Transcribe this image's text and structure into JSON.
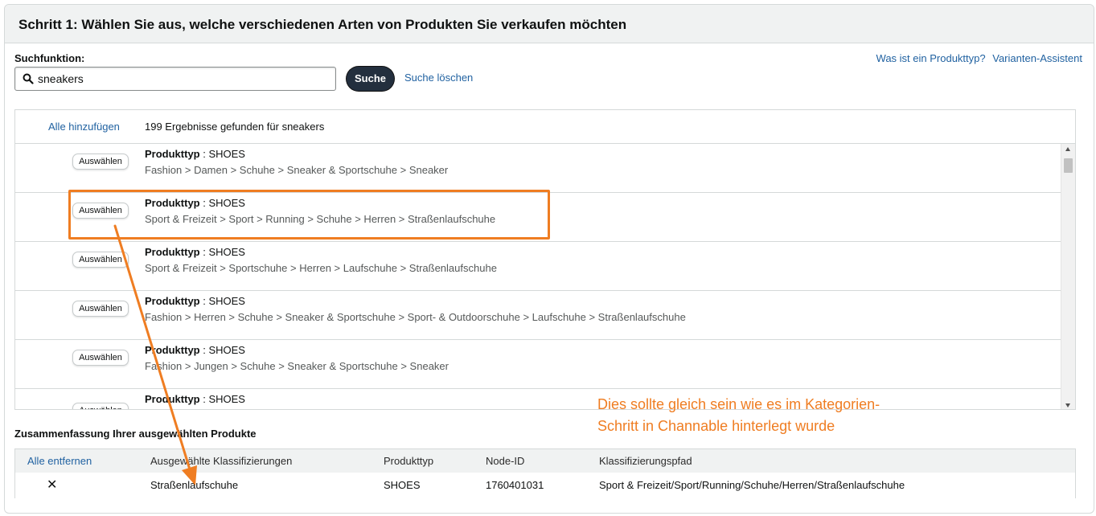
{
  "header": {
    "title": "Schritt 1: Wählen Sie aus, welche verschiedenen Arten von Produkten Sie verkaufen möchten"
  },
  "search": {
    "label": "Suchfunktion:",
    "value": "sneakers",
    "button": "Suche",
    "clear": "Suche löschen"
  },
  "help_links": [
    "Was ist ein Produkttyp?",
    "Varianten-Assistent"
  ],
  "results": {
    "add_all": "Alle hinzufügen",
    "count_text": "199 Ergebnisse gefunden für sneakers",
    "select_label": "Auswählen",
    "type_label": "Produkttyp",
    "items": [
      {
        "type": "SHOES",
        "path": "Fashion > Damen > Schuhe > Sneaker & Sportschuhe > Sneaker"
      },
      {
        "type": "SHOES",
        "path": "Sport & Freizeit > Sport > Running > Schuhe > Herren > Straßenlaufschuhe"
      },
      {
        "type": "SHOES",
        "path": "Sport & Freizeit > Sportschuhe > Herren > Laufschuhe > Straßenlaufschuhe"
      },
      {
        "type": "SHOES",
        "path": "Fashion > Herren > Schuhe > Sneaker & Sportschuhe > Sport- & Outdoorschuhe > Laufschuhe > Straßenlaufschuhe"
      },
      {
        "type": "SHOES",
        "path": "Fashion > Jungen > Schuhe > Sneaker & Sportschuhe > Sneaker"
      },
      {
        "type": "SHOES",
        "path": ""
      }
    ]
  },
  "summary": {
    "title": "Zusammenfassung Ihrer ausgewählten Produkte",
    "remove_all": "Alle entfernen",
    "columns": [
      "Ausgewählte Klassifizierungen",
      "Produkttyp",
      "Node-ID",
      "Klassifizierungspfad"
    ],
    "row": {
      "remove": "✕",
      "classification": "Straßenlaufschuhe",
      "type": "SHOES",
      "node_id": "1760401031",
      "path": "Sport & Freizeit/Sport/Running/Schuhe/Herren/Straßenlaufschuhe"
    }
  },
  "annotation": {
    "line1": "Dies sollte gleich sein wie es im Kategorien-",
    "line2": "Schritt in Channable hinterlegt wurde",
    "color": "#ef7d22"
  },
  "colors": {
    "link": "#2162a1",
    "button_dark": "#232f3e",
    "header_bg": "#f0f2f2",
    "accent": "#ef7d22"
  }
}
